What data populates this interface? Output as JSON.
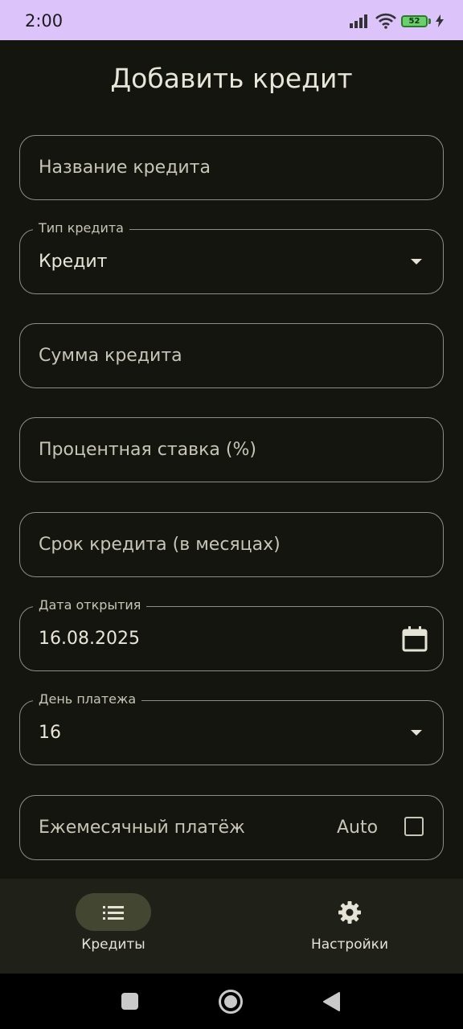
{
  "status": {
    "time": "2:00",
    "battery": "52"
  },
  "page": {
    "title": "Добавить кредит"
  },
  "form": {
    "loan_name": {
      "placeholder": "Название кредита"
    },
    "loan_type": {
      "label": "Тип кредита",
      "value": "Кредит"
    },
    "loan_amount": {
      "placeholder": "Сумма кредита"
    },
    "interest_rate": {
      "placeholder": "Процентная ставка (%)"
    },
    "loan_term": {
      "placeholder": "Срок кредита (в месяцах)"
    },
    "open_date": {
      "label": "Дата открытия",
      "value": "16.08.2025"
    },
    "payment_day": {
      "label": "День платежа",
      "value": "16"
    },
    "monthly_payment": {
      "placeholder": "Ежемесячный платёж",
      "auto_label": "Auto",
      "auto_checked": false
    }
  },
  "bottom_nav": {
    "items": [
      {
        "label": "Кредиты",
        "icon": "list-icon",
        "active": true
      },
      {
        "label": "Настройки",
        "icon": "gear-icon",
        "active": false
      }
    ]
  },
  "system_nav": {
    "icons": [
      "recents-icon",
      "home-icon",
      "back-icon"
    ]
  }
}
